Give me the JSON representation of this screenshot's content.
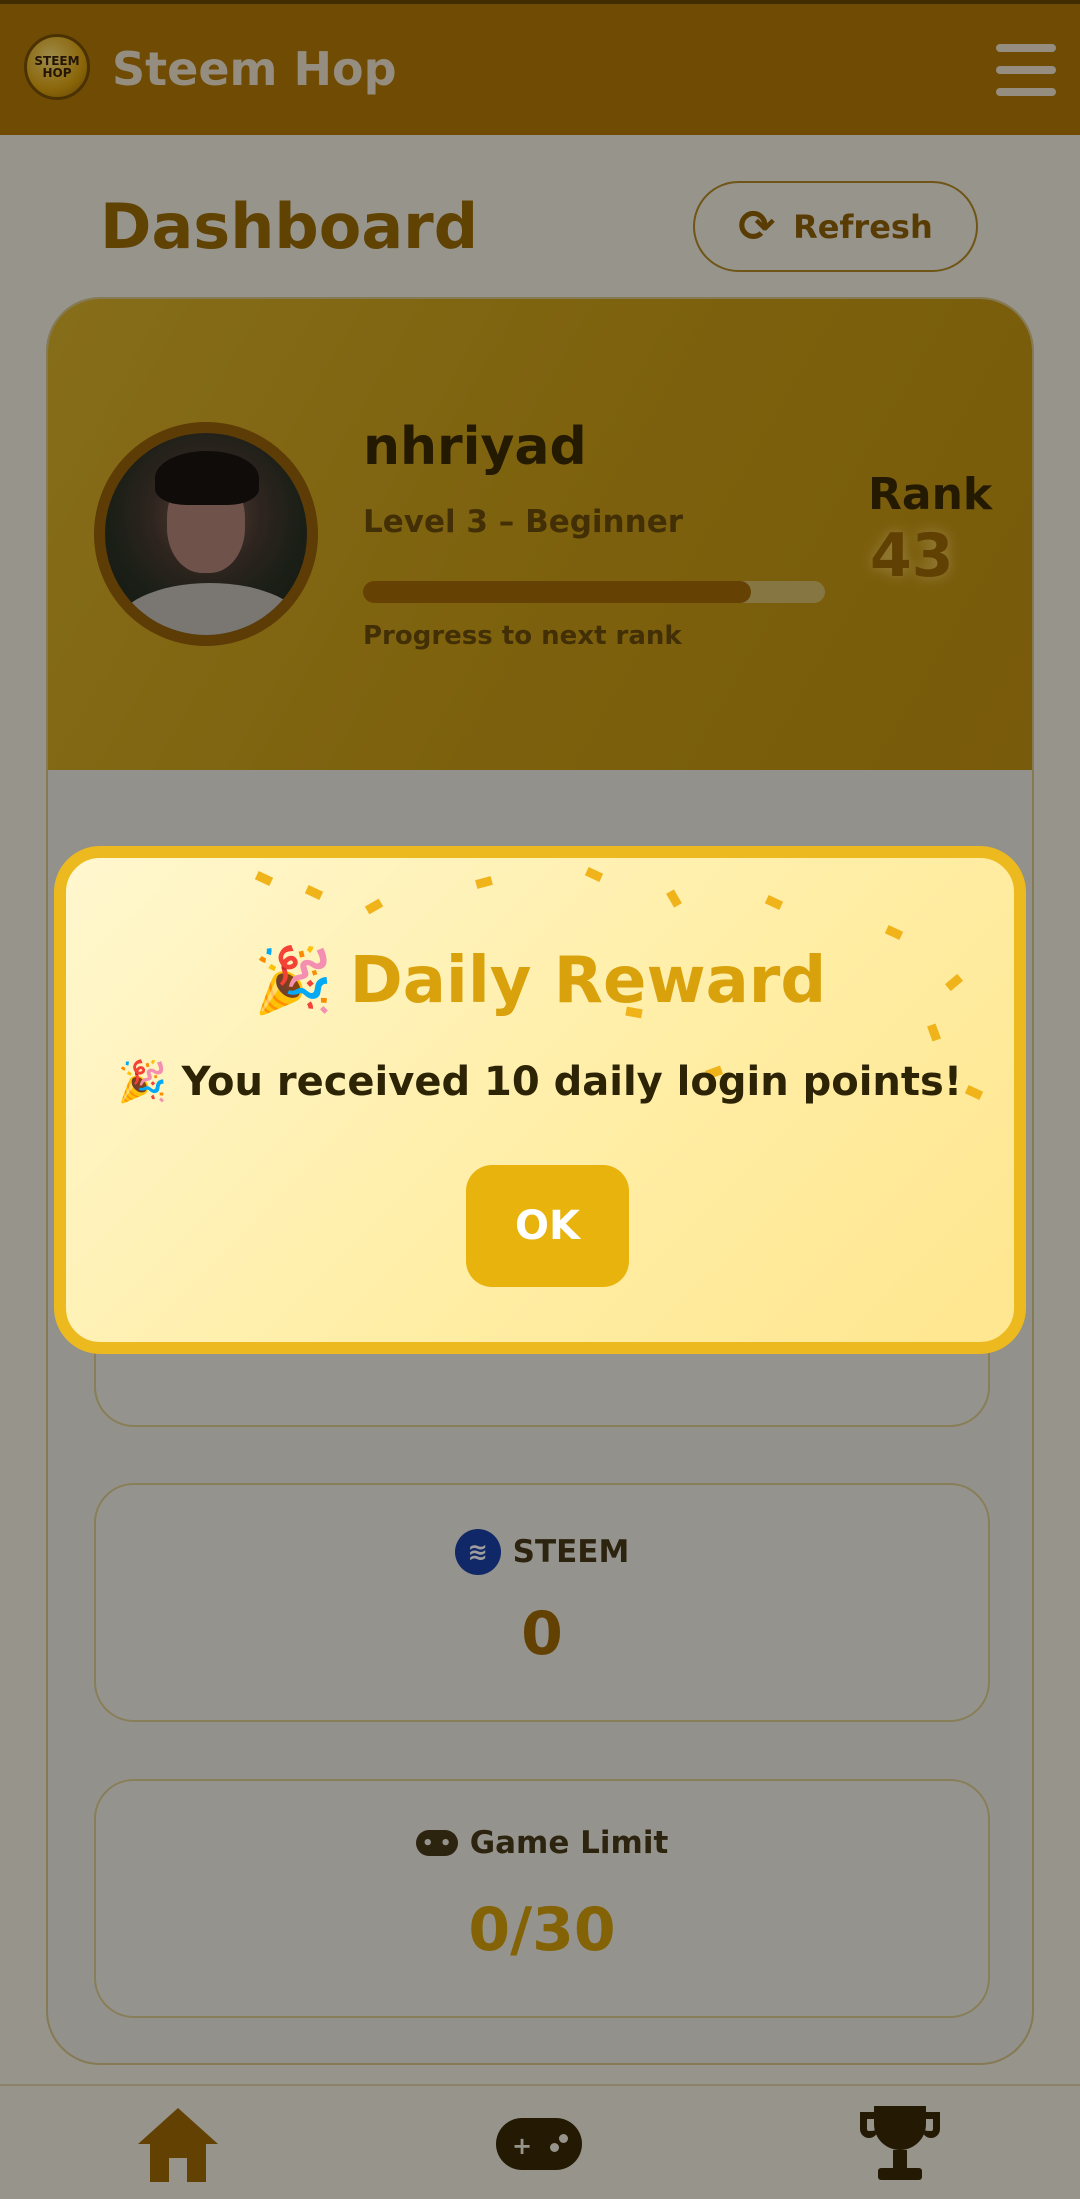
{
  "header": {
    "app_title": "Steem Hop",
    "logo_text": "STEEM HOP"
  },
  "dashboard": {
    "title": "Dashboard",
    "refresh_label": "Refresh"
  },
  "profile": {
    "username": "nhriyad",
    "level": "Level 3 – Beginner",
    "progress_fraction": 0.84,
    "progress_label": "Progress to next rank",
    "rank_label": "Rank",
    "rank_value": "43"
  },
  "stats": {
    "steem": {
      "label": "STEEM",
      "value": "0",
      "color": "#a06a06"
    },
    "game_limit": {
      "label": "Game Limit",
      "value": "0/30",
      "color": "#d3a00a"
    }
  },
  "modal": {
    "title": "Daily Reward",
    "message": "You received 10 daily login points!",
    "ok_label": "OK",
    "emoji": "🎉"
  },
  "nav": {
    "home_icon": "home-icon",
    "games_icon": "gamepad-icon",
    "leaderboard_icon": "trophy-icon"
  },
  "colors": {
    "primary": "#b37a05",
    "accent": "#ecb91e",
    "background": "#f3efe1"
  }
}
